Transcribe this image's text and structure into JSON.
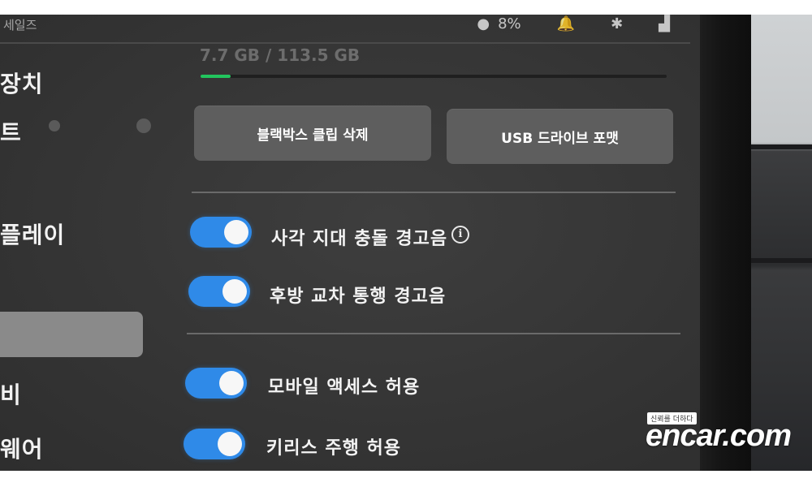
{
  "status_bar": {
    "left_text": "세일즈",
    "icons": [
      "person-icon",
      "battery-percent-text",
      "bell-icon",
      "bluetooth-icon",
      "signal-icon"
    ],
    "battery_text": "8%"
  },
  "sidebar": {
    "items": [
      {
        "label": "장치"
      },
      {
        "label": "트"
      },
      {
        "label": "플레이"
      },
      {
        "label": ""
      },
      {
        "label": "비"
      },
      {
        "label": "웨어"
      }
    ]
  },
  "storage": {
    "usage_text": "7.7 GB / 113.5 GB",
    "fill_percent": 6.5,
    "fill_color": "#22c55e"
  },
  "actions": {
    "delete_clips": "블랙박스 클립 삭제",
    "format_usb": "USB 드라이브 포맷"
  },
  "toggles": [
    {
      "label": "사각 지대 충돌 경고음",
      "on": true,
      "has_info": true
    },
    {
      "label": "후방 교차 통행 경고음",
      "on": true,
      "has_info": false
    },
    {
      "label": "모바일 액세스 허용",
      "on": true,
      "has_info": false
    },
    {
      "label": "키리스 주행 허용",
      "on": true,
      "has_info": false
    }
  ],
  "colors": {
    "accent": "#2f8ae8",
    "button": "#5e5e5e",
    "screen_bg": "#353535"
  },
  "watermark": {
    "tagline": "신뢰를 더하다",
    "logo": "encar.com"
  }
}
